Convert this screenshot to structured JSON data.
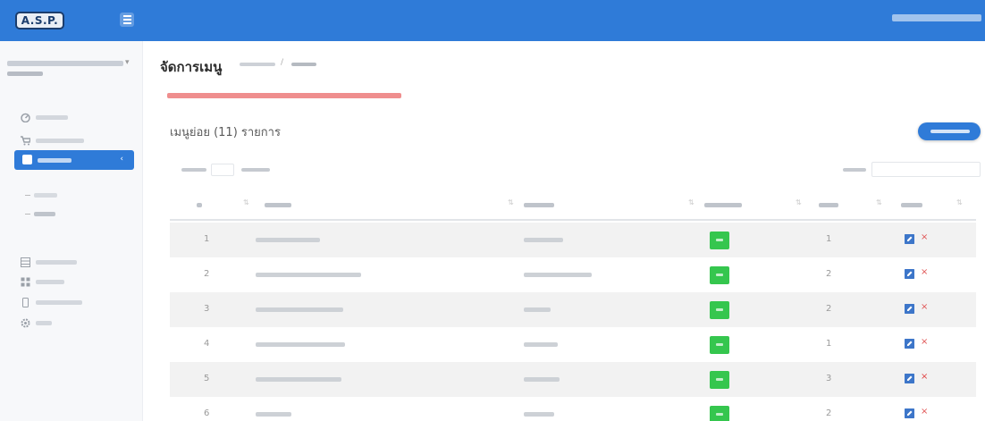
{
  "app": {
    "logo_text": "A.S.P."
  },
  "page": {
    "title": "จัดการเมนู",
    "count_label": "เมนูย่อย (11) รายการ"
  },
  "colors": {
    "primary": "#2f7bd8",
    "toggle_on": "#35c64e",
    "warning": "#e04444",
    "row_alt": "#f2f2f2"
  },
  "icons": {
    "hamburger": "hamburger-icon",
    "dashboard": "gauge-icon",
    "cart": "cart-icon",
    "menu": "checkbox-icon",
    "table": "table-icon",
    "list": "list-icon",
    "phone": "phone-icon",
    "settings": "gear-icon",
    "edit": "edit-icon",
    "delete": "delete-icon"
  },
  "table": {
    "rows": [
      {
        "num": "1",
        "order": "1",
        "status_on": true
      },
      {
        "num": "2",
        "order": "2",
        "status_on": true
      },
      {
        "num": "3",
        "order": "2",
        "status_on": true
      },
      {
        "num": "4",
        "order": "1",
        "status_on": true
      },
      {
        "num": "5",
        "order": "3",
        "status_on": true
      },
      {
        "num": "6",
        "order": "2",
        "status_on": true
      }
    ]
  }
}
